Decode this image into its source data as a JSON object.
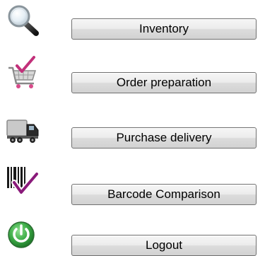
{
  "menu": {
    "items": [
      {
        "label": "Inventory",
        "icon": "magnifier-icon"
      },
      {
        "label": "Order preparation",
        "icon": "shopping-cart-check-icon"
      },
      {
        "label": "Purchase delivery",
        "icon": "delivery-truck-icon"
      },
      {
        "label": "Barcode Comparison",
        "icon": "barcode-check-icon"
      },
      {
        "label": "Logout",
        "icon": "power-icon"
      }
    ]
  },
  "colors": {
    "button_border": "#707070",
    "button_top": "#f6f6f6",
    "button_bottom": "#d2d2d2",
    "power_green": "#3fae49"
  }
}
